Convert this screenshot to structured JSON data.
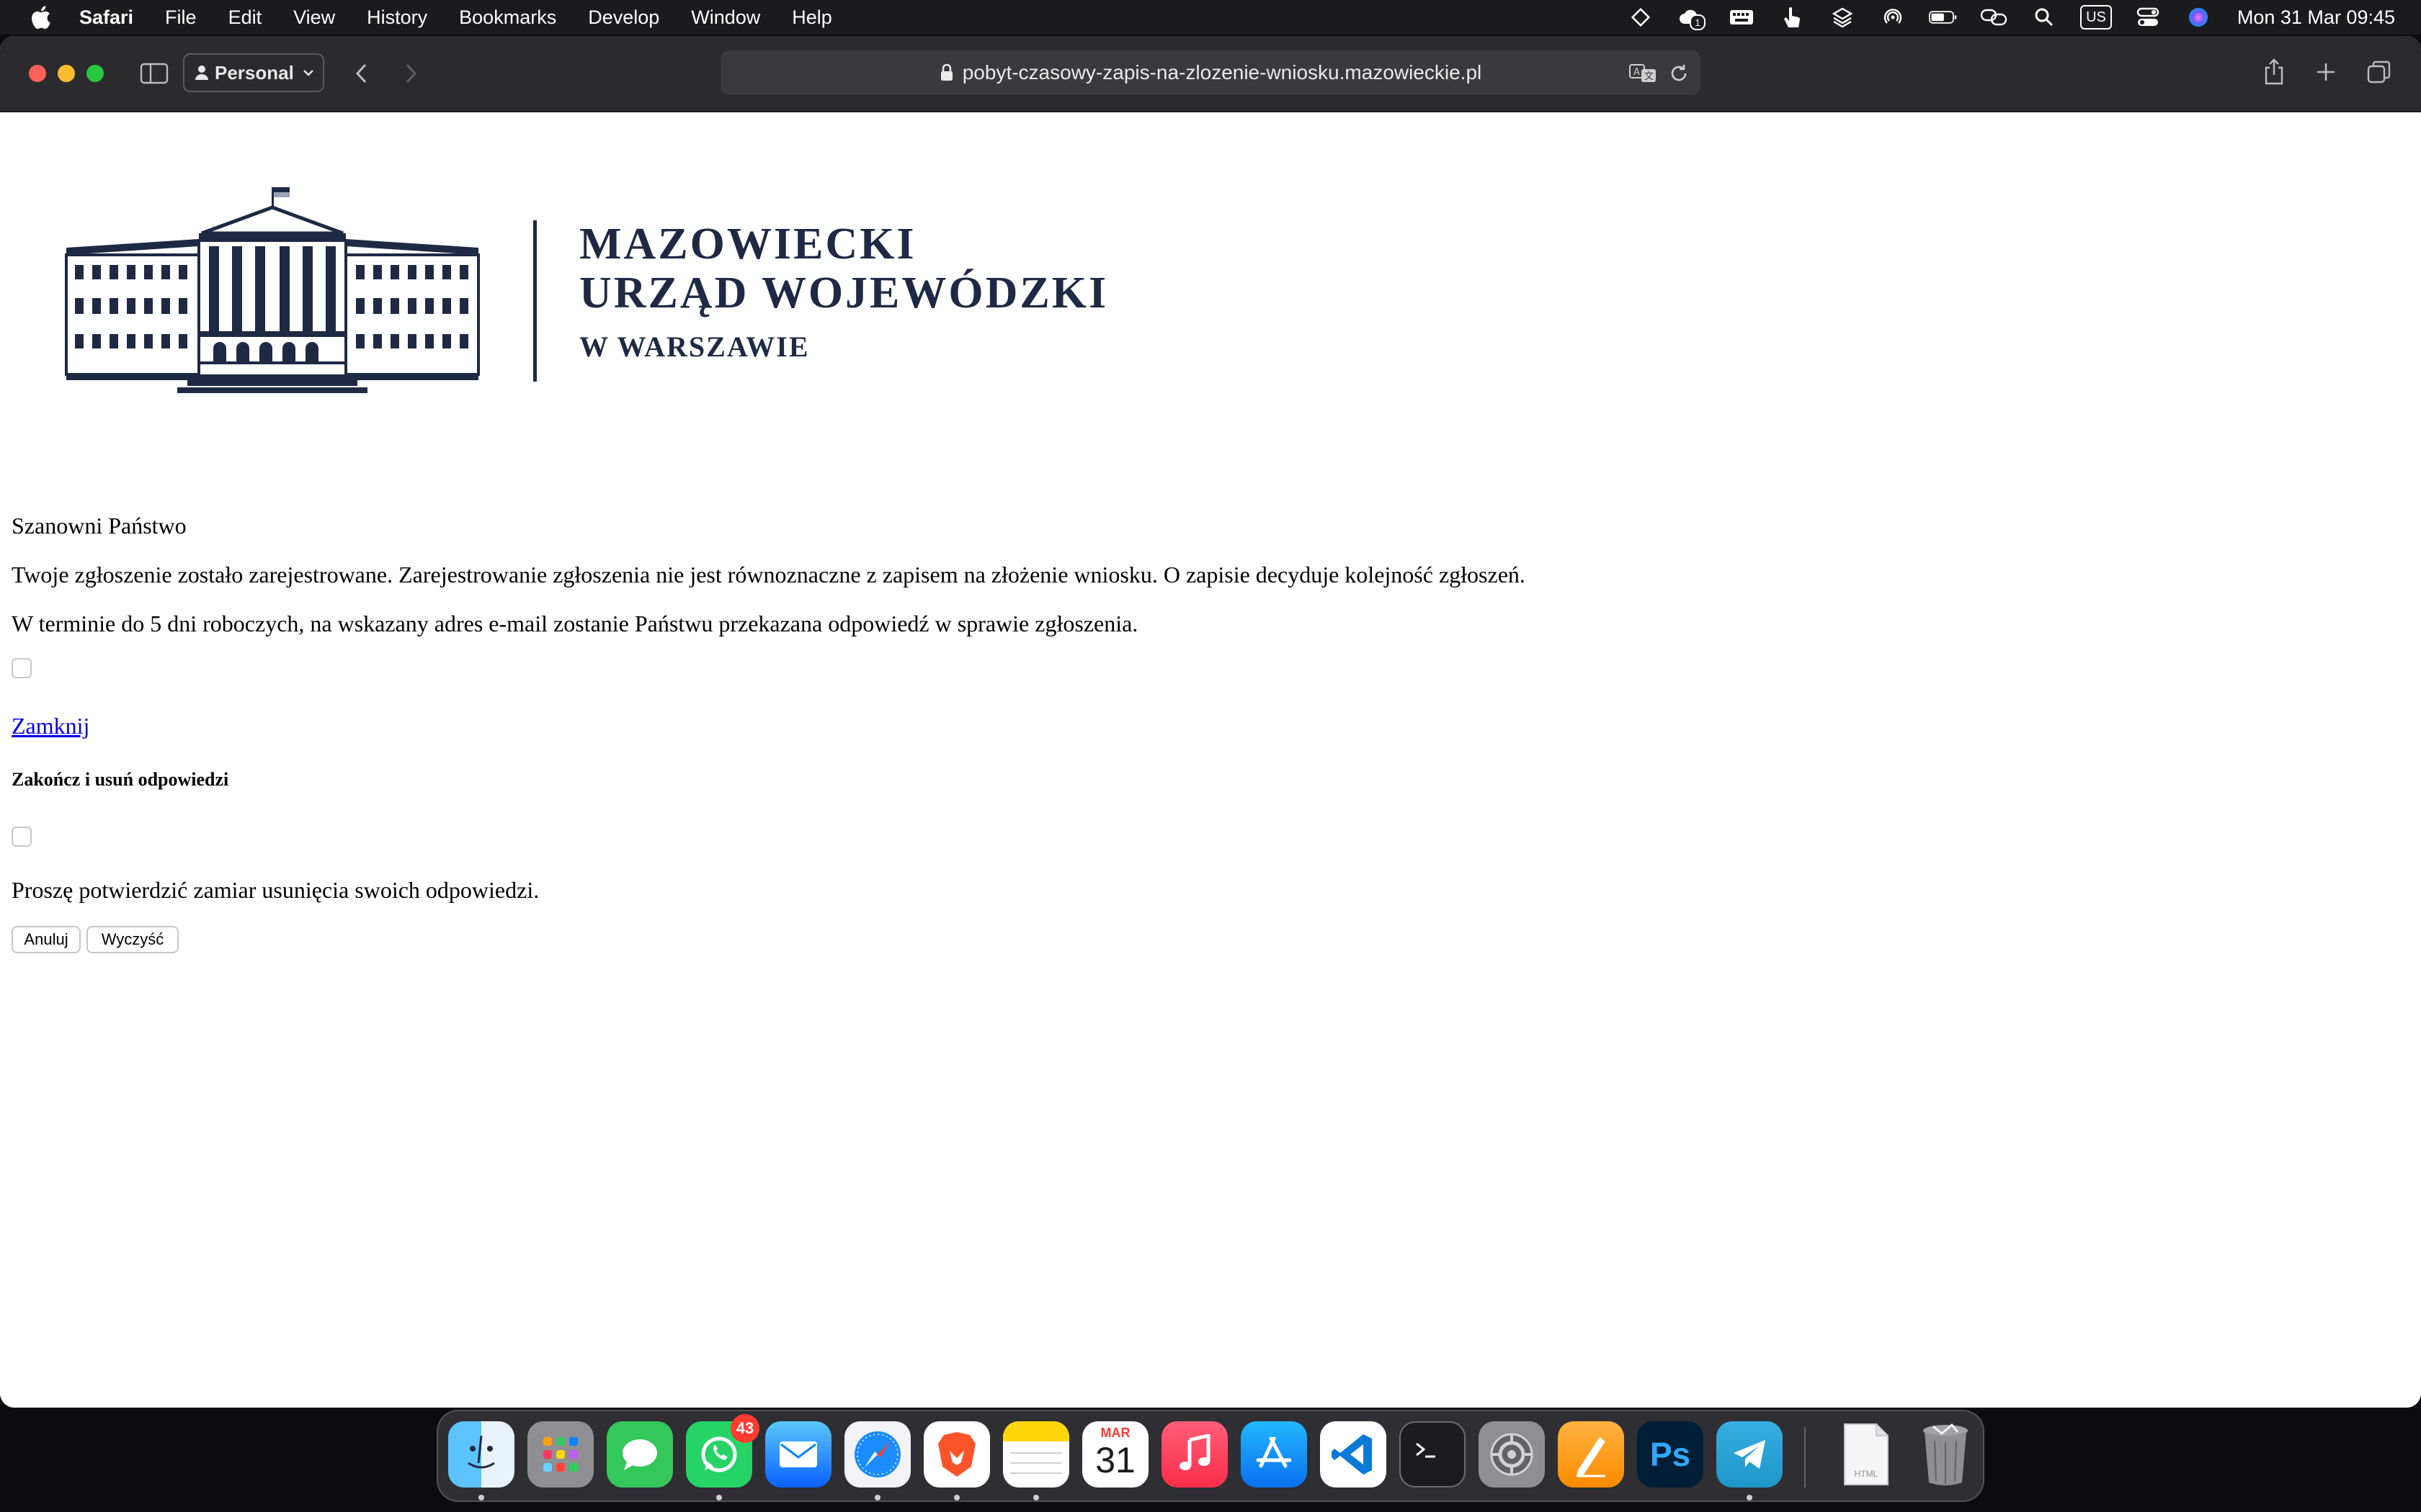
{
  "menubar": {
    "app": "Safari",
    "items": [
      "File",
      "Edit",
      "View",
      "History",
      "Bookmarks",
      "Develop",
      "Window",
      "Help"
    ],
    "input_source": "US",
    "clock": "Mon 31 Mar  09:45",
    "notification_badge": "1"
  },
  "toolbar": {
    "profile_label": "Personal",
    "url": "pobyt-czasowy-zapis-na-zlozenie-wniosku.mazowieckie.pl"
  },
  "logo": {
    "line1": "MAZOWIECKI",
    "line2": "URZĄD WOJEWÓDZKI",
    "line3": "W WARSZAWIE"
  },
  "page": {
    "greeting": "Szanowni Państwo",
    "message1": "Twoje zgłoszenie zostało zarejestrowane. Zarejestrowanie zgłoszenia nie jest równoznaczne z zapisem na złożenie wniosku. O zapisie decyduje kolejność zgłoszeń.",
    "message2": "W terminie do 5 dni roboczych, na wskazany adres e-mail zostanie Państwu przekazana odpowiedź w sprawie zgłoszenia.",
    "close_link": "Zamknij",
    "end_heading": "Zakończ i usuń odpowiedzi",
    "confirm_message": "Proszę potwierdzić zamiar usunięcia swoich odpowiedzi.",
    "cancel_label": "Anuluj",
    "clear_label": "Wyczyść"
  },
  "dock": {
    "calendar_month": "MAR",
    "calendar_day": "31",
    "whatsapp_badge": "43",
    "photoshop_label": "Ps",
    "html_file_label": "HTML"
  },
  "colors": {
    "logo_navy": "#1e2a44",
    "link_blue": "#0000ee",
    "toolbar_bg": "#2b2b2d",
    "menubar_bg": "#1b1b1d"
  }
}
